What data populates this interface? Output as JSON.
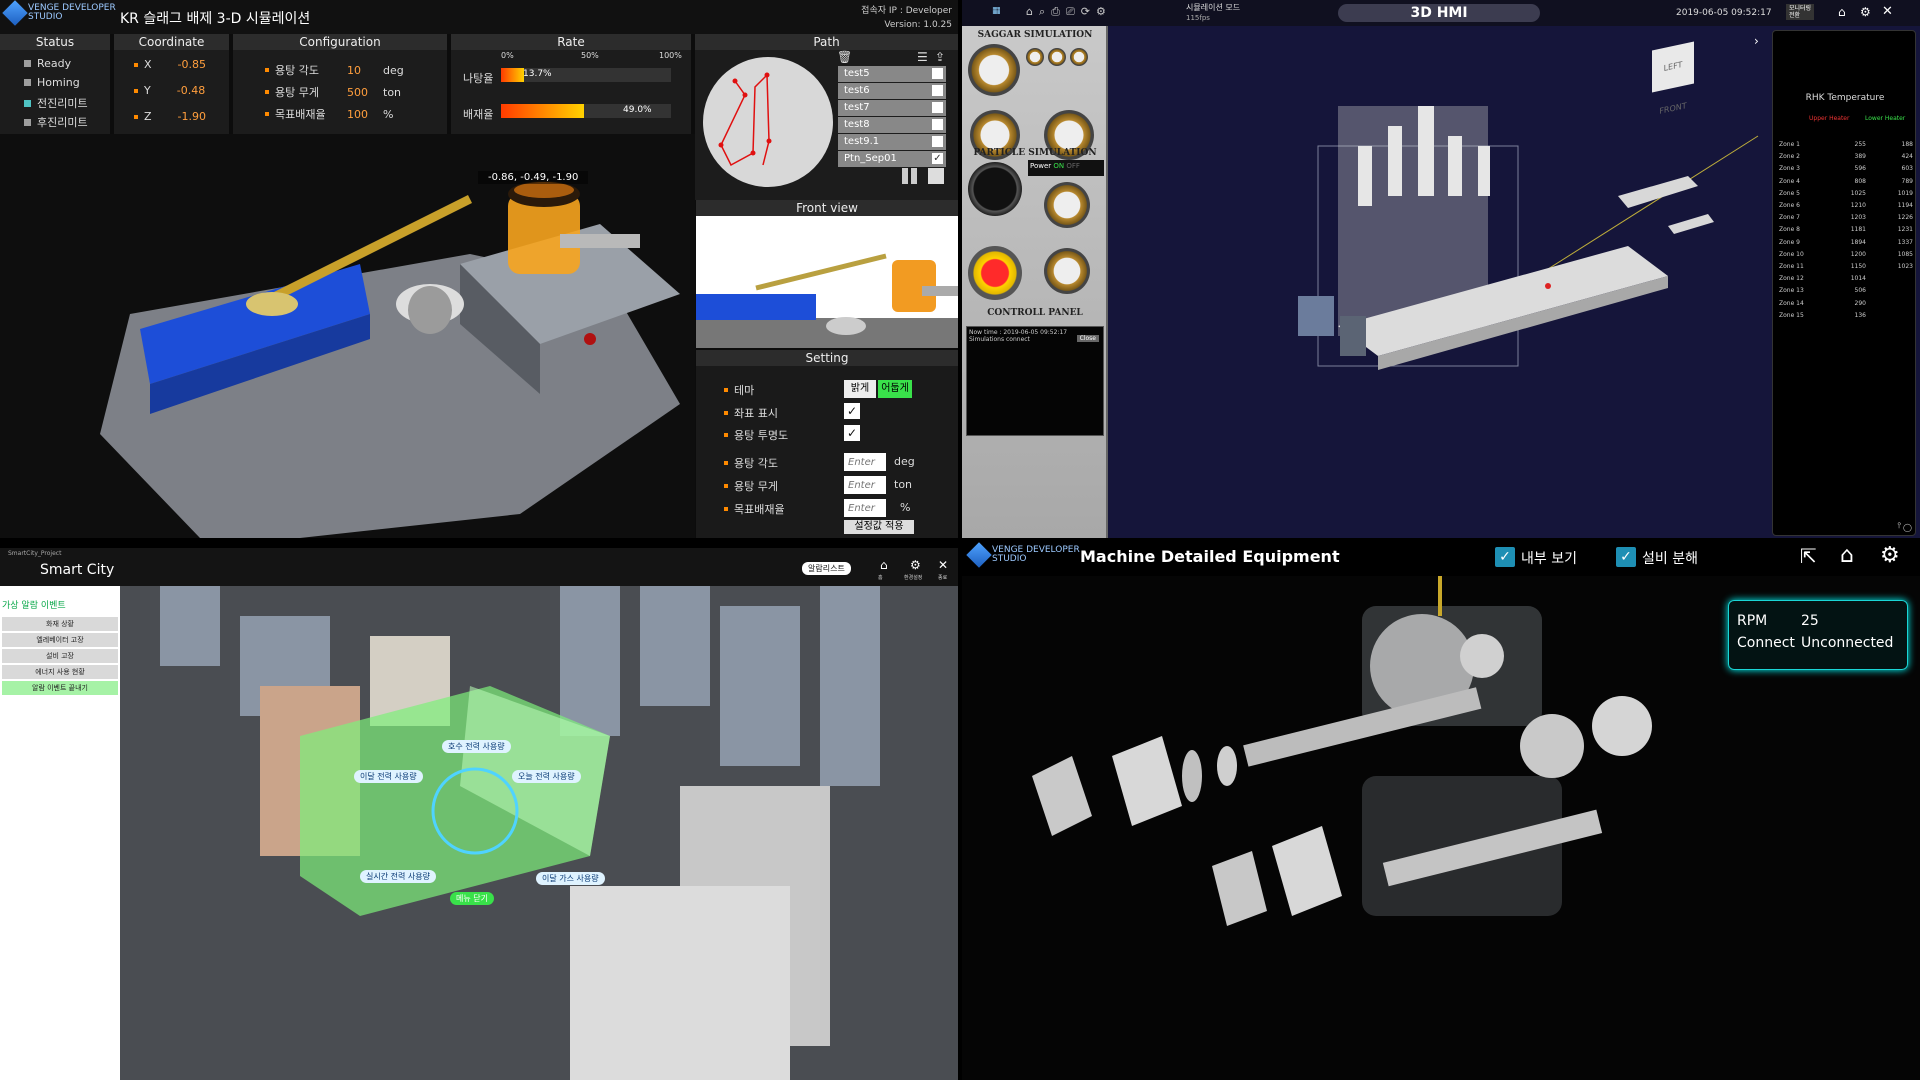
{
  "q1": {
    "logo": "VENGE DEVELOPER\nSTUDIO",
    "title": "KR 슬래그 배제 3-D 시뮬레이션",
    "user": "접속자 IP : Developer",
    "version": "Version: 1.0.25",
    "status": {
      "header": "Status",
      "items": [
        {
          "label": "Ready",
          "color": "#9e9e9e"
        },
        {
          "label": "Homing",
          "color": "#9e9e9e"
        },
        {
          "label": "전진리미트",
          "color": "#4fc3c3"
        },
        {
          "label": "후진리미트",
          "color": "#9e9e9e"
        }
      ]
    },
    "coordinate": {
      "header": "Coordinate",
      "items": [
        {
          "axis": "X",
          "value": "-0.85"
        },
        {
          "axis": "Y",
          "value": "-0.48"
        },
        {
          "axis": "Z",
          "value": "-1.90"
        }
      ]
    },
    "configuration": {
      "header": "Configuration",
      "items": [
        {
          "label": "용탕 각도",
          "value": "10",
          "unit": "deg"
        },
        {
          "label": "용탕 무게",
          "value": "500",
          "unit": "ton"
        },
        {
          "label": "목표배재율",
          "value": "100",
          "unit": "%"
        }
      ]
    },
    "rate": {
      "header": "Rate",
      "ticks": [
        "0%",
        "50%",
        "100%"
      ],
      "items": [
        {
          "label": "나탕율",
          "value": "13.7%",
          "fraction": 0.137
        },
        {
          "label": "배재율",
          "value": "49.0%",
          "fraction": 0.49
        }
      ]
    },
    "path": {
      "header": "Path",
      "items": [
        "test5",
        "test6",
        "test7",
        "test8",
        "test9.1",
        "Ptn_Sep01"
      ],
      "checked": "Ptn_Sep01"
    },
    "coord_label": "-0.86, -0.49, -1.90",
    "front_view": "Front view",
    "setting": {
      "header": "Setting",
      "theme_label": "테마",
      "theme_light": "밝게",
      "theme_dark": "어둡게",
      "coord_show": "좌표 표시",
      "transparency": "용탕 투명도",
      "angle": "용탕 각도",
      "angle_unit": "deg",
      "weight": "용탕 무게",
      "weight_unit": "ton",
      "target": "목표배재율",
      "target_unit": "%",
      "placeholder": "Enter",
      "apply": "설정값 적용"
    }
  },
  "q2": {
    "title": "3D HMI",
    "mode": "시뮬레이션 모드",
    "fps": "115fps",
    "datetime": "2019-06-05  09:52:17",
    "monitor_btn": "모니터링\n전환",
    "saggar": "SAGGAR SIMULATION",
    "particle": "PARTICLE SIMULATION",
    "control": "CONTROLL PANEL",
    "power": "Power",
    "on": "ON",
    "off": "OFF",
    "now_time": "Now time : 2019-06-05  09:52:17",
    "sim_connect": "Simulations connect",
    "close": "Close",
    "cube_left": "LEFT",
    "cube_front": "FRONT",
    "temp_title": "RHK Temperature",
    "upper": "Upper Heater",
    "lower": "Lower Heater",
    "zones": [
      {
        "zone": "Zone 1",
        "upper": "255",
        "lower": "188"
      },
      {
        "zone": "Zone 2",
        "upper": "389",
        "lower": "424"
      },
      {
        "zone": "Zone 3",
        "upper": "596",
        "lower": "603"
      },
      {
        "zone": "Zone 4",
        "upper": "808",
        "lower": "789"
      },
      {
        "zone": "Zone 5",
        "upper": "1025",
        "lower": "1019"
      },
      {
        "zone": "Zone 6",
        "upper": "1210",
        "lower": "1194"
      },
      {
        "zone": "Zone 7",
        "upper": "1203",
        "lower": "1226"
      },
      {
        "zone": "Zone 8",
        "upper": "1181",
        "lower": "1231"
      },
      {
        "zone": "Zone 9",
        "upper": "1894",
        "lower": "1337"
      },
      {
        "zone": "Zone 10",
        "upper": "1200",
        "lower": "1085"
      },
      {
        "zone": "Zone 11",
        "upper": "1150",
        "lower": "1023"
      },
      {
        "zone": "Zone 12",
        "upper": "1014",
        "lower": ""
      },
      {
        "zone": "Zone 13",
        "upper": "506",
        "lower": ""
      },
      {
        "zone": "Zone 14",
        "upper": "290",
        "lower": ""
      },
      {
        "zone": "Zone 15",
        "upper": "136",
        "lower": ""
      }
    ]
  },
  "q3": {
    "project": "SmartCity_Project",
    "title": "Smart City",
    "alarm_btn": "알람리스트",
    "home": "홈",
    "settings": "환경설정",
    "close": "종료",
    "side_title": "가상 알람 이벤트",
    "side_items": [
      "화재 상황",
      "엘레베이터 고장",
      "설비 고장",
      "에너지 사용 현황",
      "알람 이벤트 끝내기"
    ],
    "labels": [
      "호수 전력 사용량",
      "이달 전력 사용량",
      "오늘 전력 사용량",
      "실시간 전력 사용량",
      "이달 가스 사용량"
    ],
    "menu_close": "메뉴 닫기"
  },
  "q4": {
    "logo": "VENGE DEVELOPER\nSTUDIO",
    "title": "Machine Detailed Equipment",
    "inner_view": "내부 보기",
    "disassemble": "설비 분해",
    "rpm_label": "RPM",
    "rpm_value": "25",
    "connect_label": "Connect",
    "connect_value": "Unconnected"
  }
}
